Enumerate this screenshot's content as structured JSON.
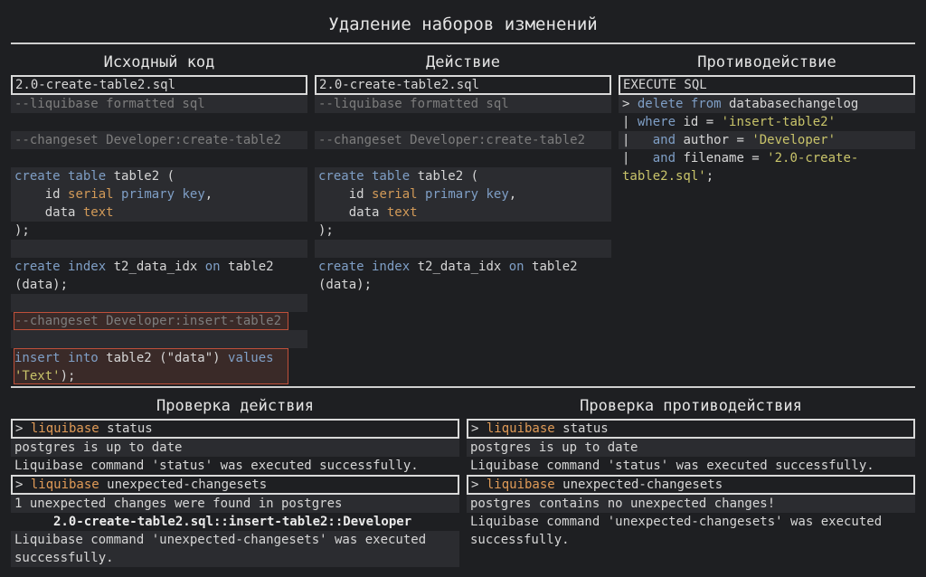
{
  "title": "Удаление наборов изменений",
  "columns": {
    "source": "Исходный код",
    "action": "Действие",
    "counter": "Противодействие"
  },
  "source_panel": {
    "file": "2.0-create-table2.sql",
    "formatted": "--liquibase formatted sql",
    "changeset1": "--changeset Developer:create-table2",
    "create_kw": "create table",
    "table_name": " table2 (",
    "id_col": "    id ",
    "serial": "serial",
    "primary_key": "primary key",
    "comma": ",",
    "data_col": "    data ",
    "text_type": "text",
    "close": ");",
    "create_index_kw": "create index",
    "index_name": " t2_data_idx ",
    "on_kw": "on",
    "index_table": " table2",
    "index_cols": "(data);",
    "changeset2": "--changeset Developer:insert-table2",
    "insert_kw": "insert into",
    "insert_rest": " table2 (\"data\") ",
    "values_kw": "values",
    "insert_val": "'Text'",
    "insert_end": ");"
  },
  "action_panel": {
    "file": "2.0-create-table2.sql",
    "formatted": "--liquibase formatted sql",
    "changeset1": "--changeset Developer:create-table2",
    "create_kw": "create table",
    "table_name": " table2 (",
    "id_col": "    id ",
    "serial": "serial",
    "primary_key": "primary key",
    "comma": ",",
    "data_col": "    data ",
    "text_type": "text",
    "close": ");",
    "create_index_kw": "create index",
    "index_name": " t2_data_idx ",
    "on_kw": "on",
    "index_table": " table2",
    "index_cols": "(data);"
  },
  "counter_panel": {
    "header": "EXECUTE SQL",
    "l1_prefix": "> ",
    "l1_kw": "delete from",
    "l1_rest": " databasechangelog",
    "l2_prefix": "| ",
    "l2_kw": "where",
    "l2_rest": " id = ",
    "l2_str": "'insert-table2'",
    "l3_prefix": "|   ",
    "l3_kw": "and",
    "l3_rest": " author = ",
    "l3_str": "'Developer'",
    "l4_prefix": "|   ",
    "l4_kw": "and",
    "l4_rest": " filename = ",
    "l4_str": "'2.0-create-",
    "l5_str": "table2.sql'",
    "l5_end": ";"
  },
  "bottom": {
    "check_action": "Проверка действия",
    "check_counter": "Проверка противодействия"
  },
  "check_action": {
    "cmd1_prompt": "> ",
    "cmd1_tool": "liquibase",
    "cmd1_arg": " status",
    "out1": "postgres is up to date",
    "out2": "Liquibase command 'status' was executed successfully.",
    "cmd2_prompt": "> ",
    "cmd2_tool": "liquibase",
    "cmd2_arg": " unexpected-changesets",
    "out3": "1 unexpected changes were found in postgres",
    "out4": "2.0-create-table2.sql::insert-table2::Developer",
    "out5": "Liquibase command 'unexpected-changesets' was executed",
    "out6": "successfully."
  },
  "check_counter": {
    "cmd1_prompt": "> ",
    "cmd1_tool": "liquibase",
    "cmd1_arg": " status",
    "out1": "postgres is up to date",
    "out2": "Liquibase command 'status' was executed successfully.",
    "cmd2_prompt": "> ",
    "cmd2_tool": "liquibase",
    "cmd2_arg": " unexpected-changesets",
    "out3": "postgres contains no unexpected changes!",
    "out4": "Liquibase command 'unexpected-changesets' was executed",
    "out5": "successfully."
  }
}
